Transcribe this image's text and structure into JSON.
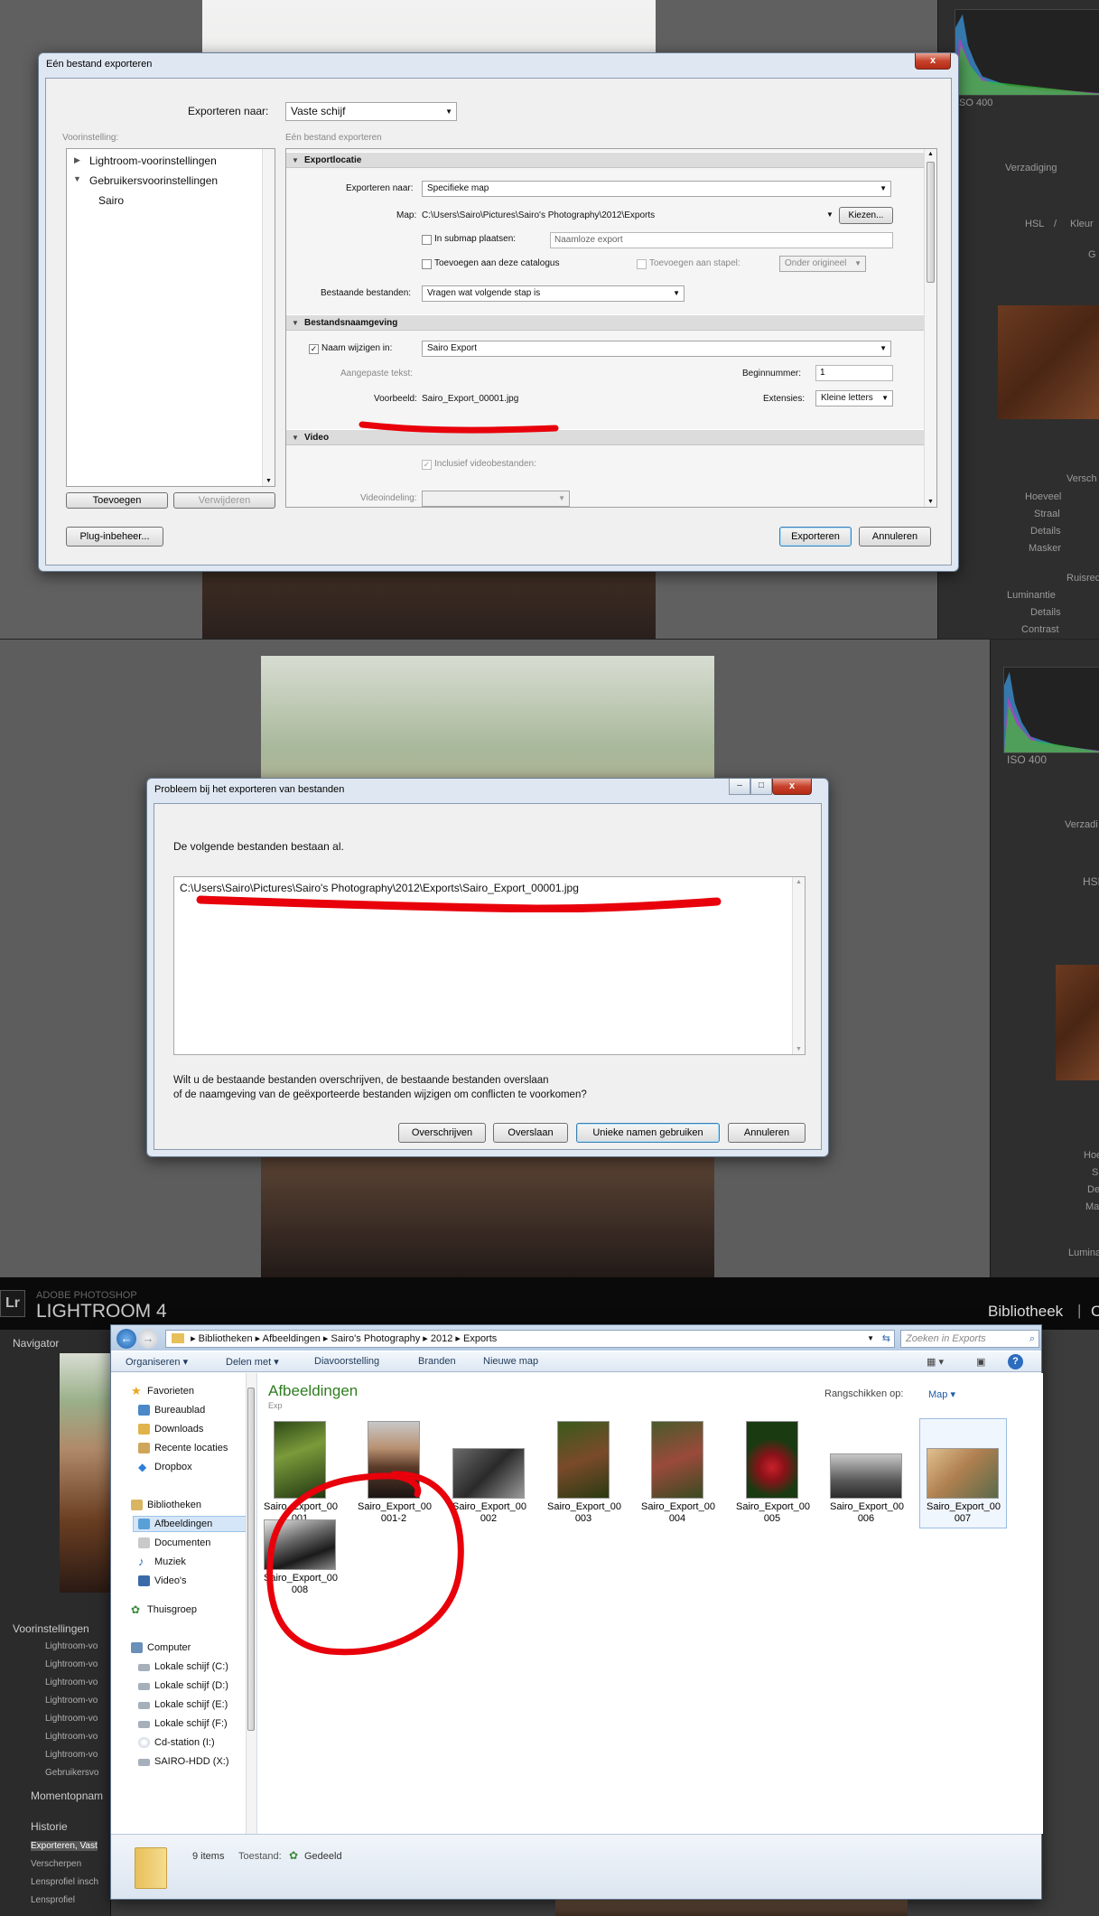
{
  "export_dialog": {
    "title": "Eén bestand exporteren",
    "close_label": "x",
    "export_to_label": "Exporteren naar:",
    "export_to_value": "Vaste schijf",
    "presets_label": "Voorinstelling:",
    "presets": [
      {
        "label": "Lightroom-voorinstellingen",
        "expander": "▶"
      },
      {
        "label": "Gebruikersvoorinstellingen",
        "expander": "▼"
      },
      {
        "label": "Sairo",
        "expander": ""
      }
    ],
    "add_button": "Toevoegen",
    "remove_button": "Verwijderen",
    "plugin_button": "Plug-inbeheer...",
    "subheading": "Eén bestand exporteren",
    "sections": {
      "location": {
        "title": "Exportlocatie",
        "export_to_label": "Exporteren naar:",
        "export_to_value": "Specifieke map",
        "folder_label": "Map:",
        "folder_value": "C:\\Users\\Sairo\\Pictures\\Sairo's Photography\\2012\\Exports",
        "choose_button": "Kiezen...",
        "subfolder_label": "In submap plaatsen:",
        "subfolder_placeholder": "Naamloze export",
        "add_catalog_label": "Toevoegen aan deze catalogus",
        "add_stack_label": "Toevoegen aan stapel:",
        "stack_value": "Onder origineel",
        "existing_label": "Bestaande bestanden:",
        "existing_value": "Vragen wat volgende stap is"
      },
      "naming": {
        "title": "Bestandsnaamgeving",
        "rename_label": "Naam wijzigen in:",
        "rename_value": "Sairo Export",
        "custom_text_label": "Aangepaste tekst:",
        "start_number_label": "Beginnummer:",
        "start_number_value": "1",
        "example_label": "Voorbeeld:",
        "example_value": "Sairo_Export_00001.jpg",
        "extensions_label": "Extensies:",
        "extensions_value": "Kleine letters"
      },
      "video": {
        "title": "Video",
        "include_label": "Inclusief videobestanden:",
        "format_label": "Videoindeling:"
      }
    },
    "export_button": "Exporteren",
    "cancel_button": "Annuleren"
  },
  "problem_dialog": {
    "title": "Probleem bij het exporteren van bestanden",
    "message": "De volgende bestanden bestaan al.",
    "file_path": "C:\\Users\\Sairo\\Pictures\\Sairo's Photography\\2012\\Exports\\Sairo_Export_00001.jpg",
    "question_line1": "Wilt u de bestaande bestanden overschrijven, de bestaande bestanden overslaan",
    "question_line2": "of de naamgeving van de geëxporteerde bestanden wijzigen om conflicten te voorkomen?",
    "overwrite_button": "Overschrijven",
    "skip_button": "Overslaan",
    "unique_button": "Unieke namen gebruiken",
    "cancel_button": "Annuleren"
  },
  "lightroom": {
    "iso_top": "ISO 400",
    "iso_mid": "ISO 400",
    "verzadiging": "Verzadiging",
    "verzadi_mid": "Verzadi",
    "hsl": "HSL",
    "slash": "/",
    "kleur": "Kleur",
    "g": "G",
    "hsl_mid": "HSL",
    "sliders_top": [
      "Versch",
      "Hoeveel",
      "Straal",
      "Details",
      "Masker"
    ],
    "ruis": "Ruisred",
    "luminantie": "Luminantie",
    "details": "Details",
    "contrast": "Contrast",
    "sliders_mid": [
      "Hoe",
      "S",
      "De",
      "Ma"
    ],
    "lumina": "Lumina",
    "logo_mark": "Lr",
    "brand_small": "ADOBE PHOTOSHOP",
    "brand_large": "LIGHTROOM 4",
    "module": "Bibliotheek",
    "module_sep": "|",
    "module_next": "C",
    "navigator": "Navigator",
    "presets_header": "Voorinstellingen",
    "preset_items": [
      "Lightroom-vo",
      "Lightroom-vo",
      "Lightroom-vo",
      "Lightroom-vo",
      "Lightroom-vo",
      "Lightroom-vo",
      "Lightroom-vo",
      "Gebruikersvo"
    ],
    "snapshots_header": "Momentopnam",
    "history_header": "Historie",
    "history_items": [
      "Exporteren, Vast",
      "Verscherpen",
      "Lensprofiel insch",
      "Lensprofiel"
    ]
  },
  "explorer": {
    "breadcrumb": [
      "Bibliotheken",
      "Afbeeldingen",
      "Sairo's Photography",
      "2012",
      "Exports"
    ],
    "search_placeholder": "Zoeken in Exports",
    "toolbar": [
      "Organiseren ▾",
      "Delen met ▾",
      "Diavoorstelling",
      "Branden",
      "Nieuwe map"
    ],
    "sidebar": {
      "favorites_header": "Favorieten",
      "favorites": [
        "Bureaublad",
        "Downloads",
        "Recente locaties",
        "Dropbox"
      ],
      "libraries_header": "Bibliotheken",
      "libraries": [
        "Afbeeldingen",
        "Documenten",
        "Muziek",
        "Video's"
      ],
      "homegroup": "Thuisgroep",
      "computer_header": "Computer",
      "drives": [
        "Lokale schijf (C:)",
        "Lokale schijf (D:)",
        "Lokale schijf (E:)",
        "Lokale schijf (F:)",
        "Cd-station (I:)",
        "SAIRO-HDD (X:)"
      ]
    },
    "library_title": "Afbeeldingen",
    "library_sub": "Exp",
    "arrange_label": "Rangschikken op:",
    "arrange_value": "Map ▾",
    "files": [
      {
        "line1": "Sairo_Export_00",
        "line2": "001"
      },
      {
        "line1": "Sairo_Export_00",
        "line2": "001-2"
      },
      {
        "line1": "Sairo_Export_00",
        "line2": "002"
      },
      {
        "line1": "Sairo_Export_00",
        "line2": "003"
      },
      {
        "line1": "Sairo_Export_00",
        "line2": "004"
      },
      {
        "line1": "Sairo_Export_00",
        "line2": "005"
      },
      {
        "line1": "Sairo_Export_00",
        "line2": "006"
      },
      {
        "line1": "Sairo_Export_00",
        "line2": "007"
      },
      {
        "line1": "Sairo_Export_00",
        "line2": "008"
      }
    ],
    "status_count": "9 items",
    "status_label": "Toestand:",
    "status_value": "Gedeeld"
  },
  "colors": {
    "annotation_red": "#e8000b",
    "explorer_title_green": "#2e7d1e",
    "lightroom_dark": "#2e2e2e"
  }
}
